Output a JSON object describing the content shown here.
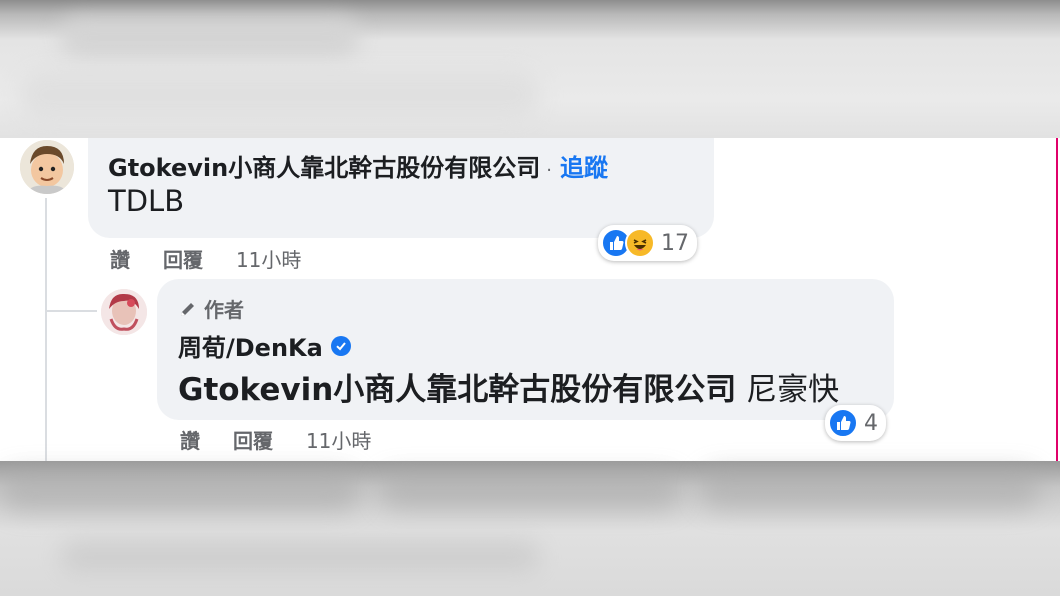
{
  "comment": {
    "author": "Gtokevin小商人靠北幹古股份有限公司",
    "separator": "·",
    "follow_label": "追蹤",
    "text": "TDLB",
    "actions": {
      "like_label": "讚",
      "reply_label": "回覆",
      "time": "11小時"
    },
    "reactions": {
      "types": [
        "like-icon",
        "haha-icon"
      ],
      "count": "17"
    }
  },
  "reply": {
    "badge_label": "作者",
    "author": "周荀/DenKa",
    "mention": "Gtokevin小商人靠北幹古股份有限公司",
    "text": "尼豪快",
    "actions": {
      "like_label": "讚",
      "reply_label": "回覆",
      "time": "11小時"
    },
    "reactions": {
      "types": [
        "like-icon"
      ],
      "count": "4"
    }
  },
  "colors": {
    "link": "#1877f2",
    "bubble": "#f0f2f5",
    "secondary_text": "#65676b"
  }
}
